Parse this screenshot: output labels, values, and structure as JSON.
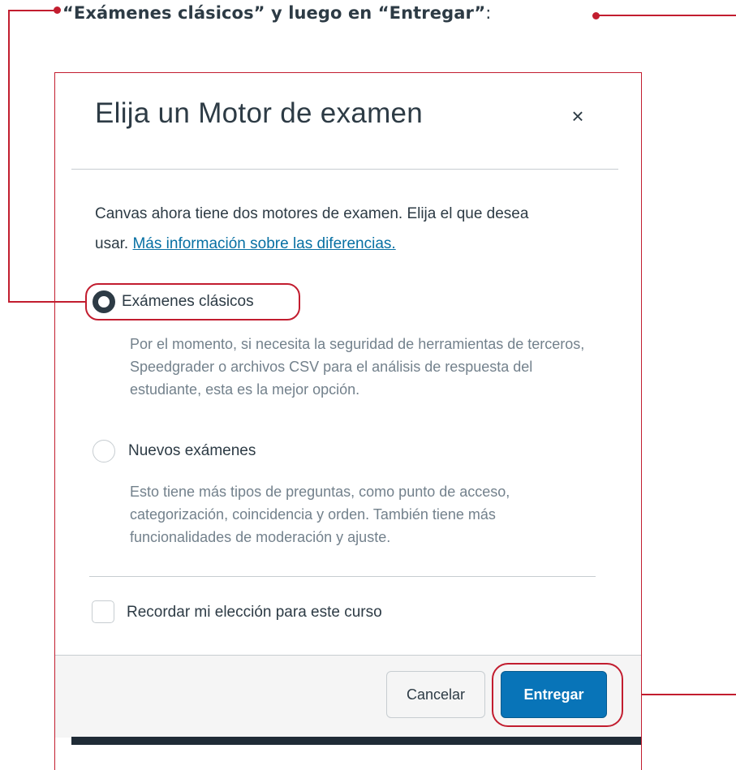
{
  "caption": {
    "text": "“Exámenes clásicos” y luego en “Entregar”",
    "suffix": ":"
  },
  "dialog": {
    "title": "Elija un Motor de examen",
    "close_symbol": "×",
    "intro_text": "Canvas ahora tiene dos motores de examen. Elija el que desea usar.",
    "intro_link": "Más información sobre las diferencias.",
    "options": [
      {
        "label": "Exámenes clásicos",
        "selected": true,
        "description": "Por el momento, si necesita la seguridad de herramientas de terceros, Speedgrader o archivos CSV para el análisis de respuesta del estudiante, esta es la mejor opción."
      },
      {
        "label": "Nuevos exámenes",
        "selected": false,
        "description": "Esto tiene más tipos de preguntas, como punto de acceso, categorización, coincidencia y orden. También tiene más funcionalidades de moderación y ajuste."
      }
    ],
    "remember_label": "Recordar mi elección para este curso",
    "remember_checked": false,
    "cancel_label": "Cancelar",
    "submit_label": "Entregar"
  },
  "colors": {
    "annotation": "#c21d2f",
    "primary_button": "#0874b8",
    "link": "#0770a3",
    "text": "#2d3b45",
    "muted_text": "#73818c"
  },
  "icons": {
    "close": "close-icon",
    "radio_selected": "radio-selected-icon",
    "radio_unselected": "radio-unselected-icon",
    "checkbox": "checkbox-icon"
  }
}
